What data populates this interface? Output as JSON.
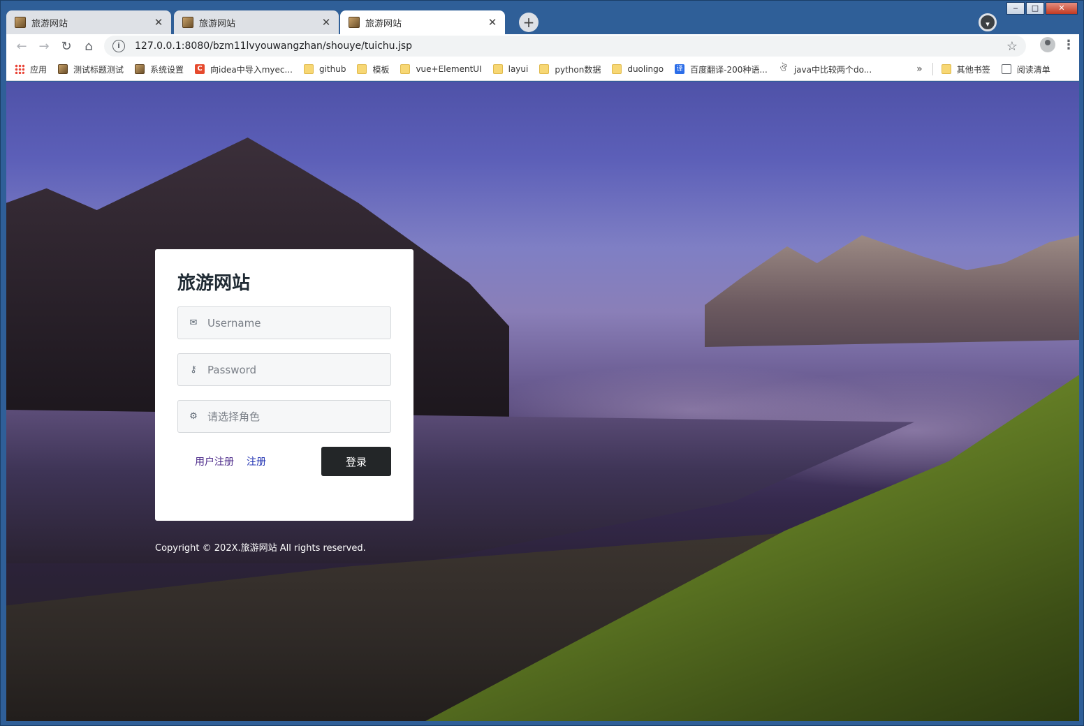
{
  "window": {
    "minimize": "‒",
    "maximize": "□",
    "close": "✕"
  },
  "tabs": [
    {
      "title": "旅游网站",
      "close": "✕"
    },
    {
      "title": "旅游网站",
      "close": "✕"
    },
    {
      "title": "旅游网站",
      "close": "✕"
    }
  ],
  "newtab": "+",
  "toolbar": {
    "back": "←",
    "forward": "→",
    "reload": "↻",
    "home": "⌂",
    "url": "127.0.0.1:8080/bzm11lvyouwangzhan/shouye/tuichu.jsp",
    "info": "i",
    "star": "☆",
    "menu": "⋮"
  },
  "bookmarks": [
    {
      "label": "应用",
      "icon": "apps-icon"
    },
    {
      "label": "测试标题测试",
      "icon": "site-icon"
    },
    {
      "label": "系统设置",
      "icon": "site-icon"
    },
    {
      "label": "向idea中导入myec...",
      "icon": "csdn-icon"
    },
    {
      "label": "github",
      "icon": "folder-icon"
    },
    {
      "label": "模板",
      "icon": "folder-icon"
    },
    {
      "label": "vue+ElementUI",
      "icon": "folder-icon"
    },
    {
      "label": "layui",
      "icon": "folder-icon"
    },
    {
      "label": "python数据",
      "icon": "folder-icon"
    },
    {
      "label": "duolingo",
      "icon": "folder-icon"
    },
    {
      "label": "百度翻译-200种语...",
      "icon": "baidu-translate-icon"
    },
    {
      "label": "java中比较两个do...",
      "icon": "java-icon"
    }
  ],
  "bookmarks_more": "»",
  "other_bookmarks": "其他书签",
  "reading_list": "阅读清单",
  "login": {
    "title": "旅游网站",
    "username_placeholder": "Username",
    "password_placeholder": "Password",
    "role_placeholder": "请选择角色",
    "user_register": "用户注册",
    "register": "注册",
    "submit": "登录"
  },
  "footer": {
    "copyright": "Copyright © 202X.旅游网站 All rights reserved."
  }
}
